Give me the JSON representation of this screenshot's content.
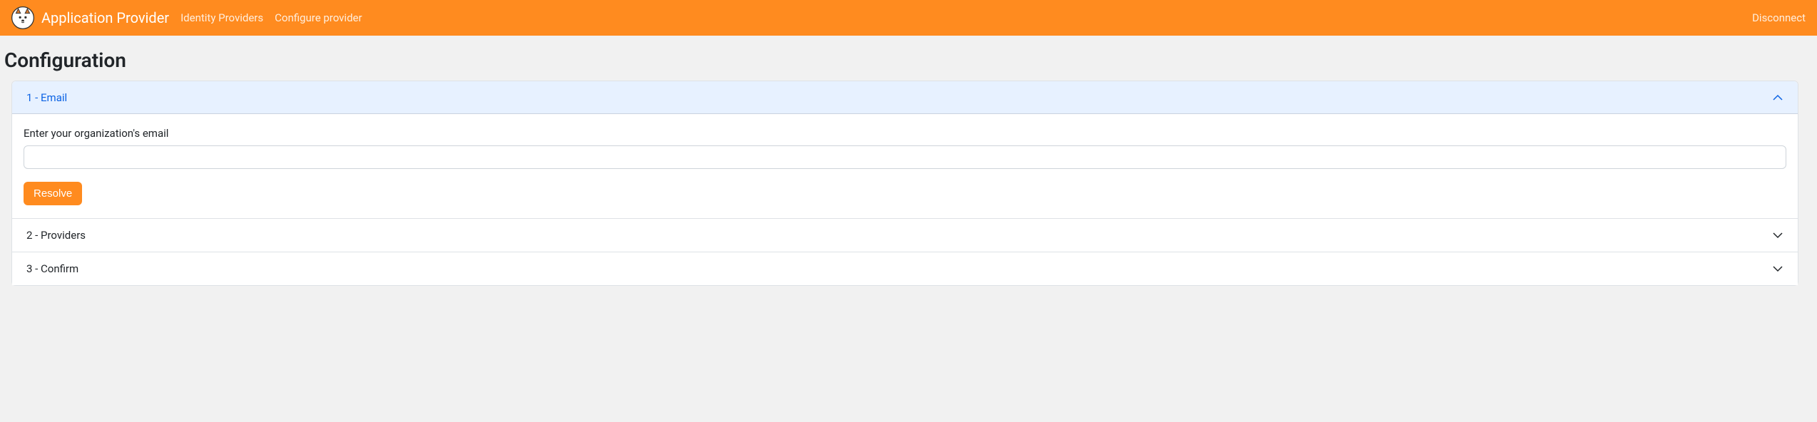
{
  "navbar": {
    "brand": "Application Provider",
    "links": [
      {
        "label": "Identity Providers"
      },
      {
        "label": "Configure provider"
      }
    ],
    "right_link": "Disconnect"
  },
  "page": {
    "title": "Configuration"
  },
  "accordion": {
    "steps": [
      {
        "label": "1 - Email",
        "expanded": true
      },
      {
        "label": "2 - Providers",
        "expanded": false
      },
      {
        "label": "3 - Confirm",
        "expanded": false
      }
    ]
  },
  "email_step": {
    "prompt": "Enter your organization's email",
    "value": "",
    "button_label": "Resolve"
  },
  "colors": {
    "accent": "#ff8b1f",
    "active_bg": "#e7f1ff",
    "active_text": "#0c63e4"
  }
}
